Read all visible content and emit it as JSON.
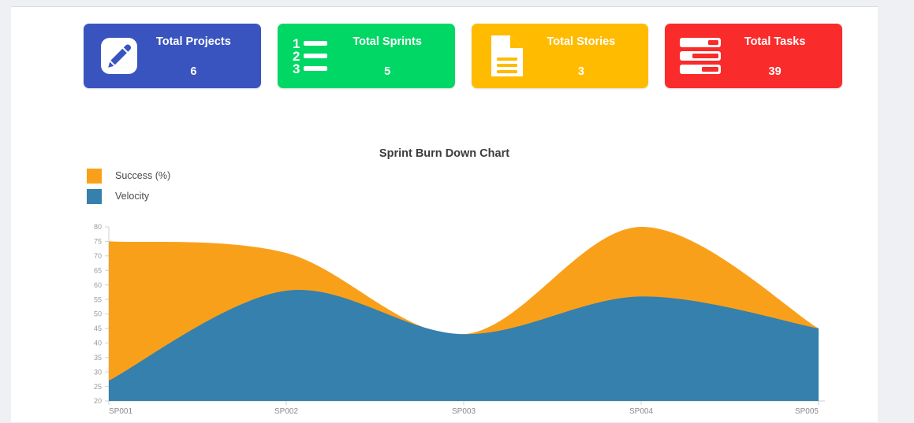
{
  "cards": [
    {
      "id": "total-projects",
      "title": "Total Projects",
      "value": "6",
      "color": "#3a54bf",
      "icon": "pencil-icon"
    },
    {
      "id": "total-sprints",
      "title": "Total Sprints",
      "value": "5",
      "color": "#00d764",
      "icon": "ordered-list-icon"
    },
    {
      "id": "total-stories",
      "title": "Total Stories",
      "value": "3",
      "color": "#ffbb00",
      "icon": "document-icon"
    },
    {
      "id": "total-tasks",
      "title": "Total Tasks",
      "value": "39",
      "color": "#fa2b2b",
      "icon": "tasks-icon"
    }
  ],
  "chart_data": {
    "type": "area",
    "title": "Sprint Burn Down Chart",
    "xlabel": "",
    "ylabel": "",
    "categories": [
      "SP001",
      "SP002",
      "SP003",
      "SP004",
      "SP005"
    ],
    "series": [
      {
        "name": "Success (%)",
        "color": "#f9a01b",
        "values": [
          75,
          71,
          43,
          80,
          45
        ]
      },
      {
        "name": "Velocity",
        "color": "#3580ad",
        "values": [
          27,
          58,
          43,
          56,
          45
        ]
      }
    ],
    "ylim": [
      20,
      80
    ],
    "yticks": [
      20,
      25,
      30,
      35,
      40,
      45,
      50,
      55,
      60,
      65,
      70,
      75,
      80
    ],
    "ytick_labels": [
      "20",
      "25",
      "30",
      "35",
      "40",
      "45",
      "50",
      "55",
      "60",
      "65",
      "70",
      "75",
      "80"
    ],
    "grid": false,
    "legend_position": "top-left",
    "smoothing": "spline"
  }
}
